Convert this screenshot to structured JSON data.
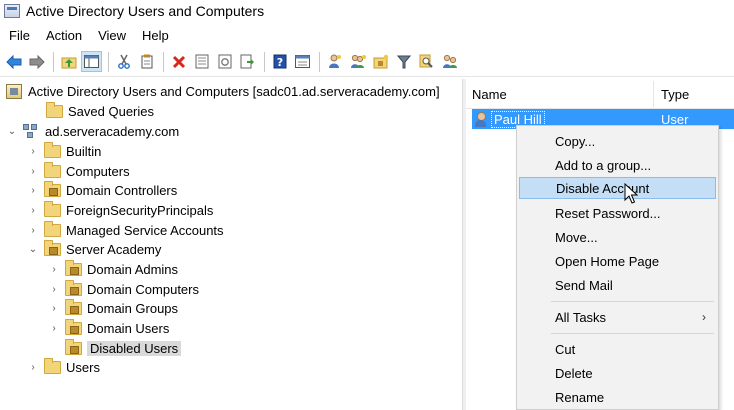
{
  "window": {
    "title": "Active Directory Users and Computers"
  },
  "menu": [
    "File",
    "Action",
    "View",
    "Help"
  ],
  "toolbar": {
    "icons": [
      "back-arrow-icon",
      "forward-arrow-icon",
      "up-folder-icon",
      "show-hide-console-tree-icon",
      "cut-icon",
      "copy-icon",
      "delete-icon",
      "properties-icon",
      "refresh-icon",
      "export-list-icon",
      "help-icon",
      "console-view-icon",
      "new-user-icon",
      "new-group-icon",
      "new-ou-icon",
      "filter-icon",
      "find-icon",
      "add-to-group-icon"
    ]
  },
  "tree": {
    "root": "Active Directory Users and Computers [sadc01.ad.serveracademy.com]",
    "saved_queries": "Saved Queries",
    "domain": "ad.serveracademy.com",
    "children": [
      {
        "label": "Builtin",
        "type": "folder"
      },
      {
        "label": "Computers",
        "type": "folder"
      },
      {
        "label": "Domain Controllers",
        "type": "ou"
      },
      {
        "label": "ForeignSecurityPrincipals",
        "type": "folder"
      },
      {
        "label": "Managed Service Accounts",
        "type": "folder"
      },
      {
        "label": "Server Academy",
        "type": "ou"
      }
    ],
    "server_academy_children": [
      {
        "label": "Domain Admins"
      },
      {
        "label": "Domain Computers"
      },
      {
        "label": "Domain Groups"
      },
      {
        "label": "Domain Users"
      },
      {
        "label": "Disabled Users"
      }
    ],
    "last": "Users"
  },
  "list": {
    "columns": {
      "name": "Name",
      "type": "Type"
    },
    "rows": [
      {
        "name": "Paul Hill",
        "type": "User"
      }
    ]
  },
  "context_menu": {
    "items": [
      "Copy...",
      "Add to a group...",
      "Disable Account",
      "Reset Password...",
      "Move...",
      "Open Home Page",
      "Send Mail",
      "All Tasks",
      "Cut",
      "Delete",
      "Rename"
    ],
    "hovered": "Disable Account",
    "submenu_arrow": "›"
  }
}
